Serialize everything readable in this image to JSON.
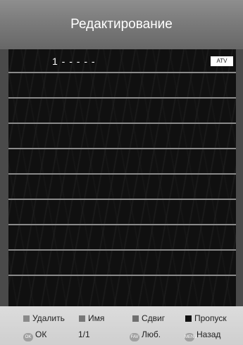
{
  "header": {
    "title": "Редактирование"
  },
  "channels": [
    {
      "label": "1 - - - - -",
      "badge": "ATV"
    },
    {
      "label": "",
      "badge": ""
    },
    {
      "label": "",
      "badge": ""
    },
    {
      "label": "",
      "badge": ""
    },
    {
      "label": "",
      "badge": ""
    },
    {
      "label": "",
      "badge": ""
    },
    {
      "label": "",
      "badge": ""
    },
    {
      "label": "",
      "badge": ""
    },
    {
      "label": "",
      "badge": ""
    },
    {
      "label": "",
      "badge": ""
    }
  ],
  "footer": {
    "delete_label": "Удалить",
    "name_label": "Имя",
    "move_label": "Сдвиг",
    "skip_label": "Пропуск",
    "ok_icon": "OK",
    "ok_label": "ОК",
    "page": "1/1",
    "fav_icon": "FAV",
    "fav_label": "Люб.",
    "back_icon": "MENU",
    "back_label": "Назад",
    "colors": {
      "delete": "#8a8a8a",
      "name": "#777777",
      "move": "#6f6f6f",
      "skip": "#111111"
    }
  }
}
